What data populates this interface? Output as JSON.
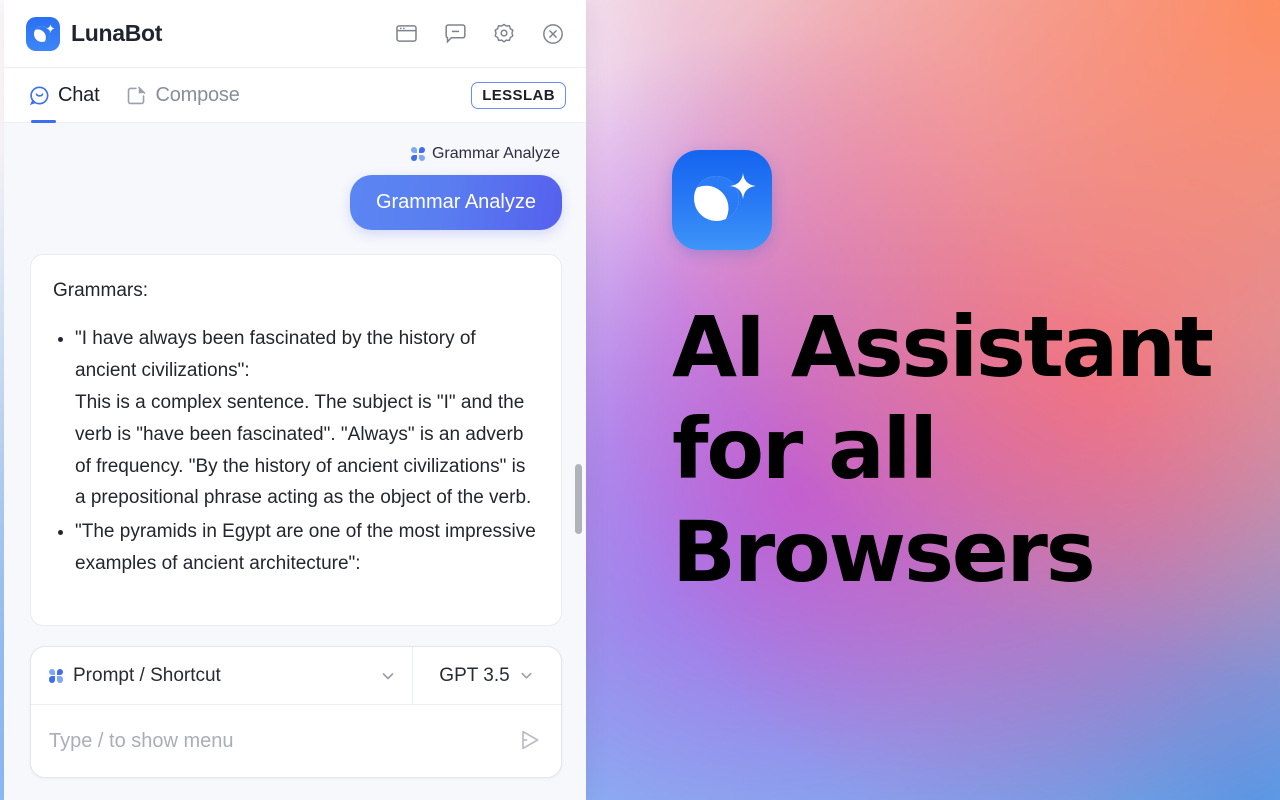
{
  "marketing": {
    "logo_icon": "luna-moon-sparkle-logo",
    "headline_lines": [
      "AI Assistant",
      "for all",
      "Browsers"
    ]
  },
  "titlebar": {
    "brand_name": "LunaBot",
    "logo_icon": "luna-moon-sparkle-logo",
    "actions": [
      {
        "icon": "sidebar-panel-icon",
        "name": "sidebar-toggle-button"
      },
      {
        "icon": "chat-minus-icon",
        "name": "collapse-chat-button"
      },
      {
        "icon": "gear-icon",
        "name": "settings-button"
      },
      {
        "icon": "close-circle-icon",
        "name": "close-button"
      }
    ]
  },
  "tabbar": {
    "tabs": [
      {
        "label": "Chat",
        "icon": "chat-smile-icon",
        "active": true
      },
      {
        "label": "Compose",
        "icon": "compose-pencil-icon",
        "active": false
      }
    ],
    "badge": "LESSLAB"
  },
  "conversation": {
    "prompt_label": "Grammar Analyze",
    "prompt_label_icon": "clover-four-dots-icon",
    "user_message": "Grammar Analyze",
    "assistant": {
      "intro": "Grammars:",
      "items": [
        {
          "quote": "\"I have always been fascinated by the history of ancient civilizations\":",
          "body": "This is a complex sentence. The subject is \"I\" and the verb is \"have been fascinated\". \"Always\" is an adverb of frequency. \"By the history of ancient civilizations\" is a prepositional phrase acting as the object of the verb."
        },
        {
          "quote": "\"The pyramids in Egypt are one of the most impressive examples of ancient architecture\":",
          "body": ""
        }
      ]
    }
  },
  "composer": {
    "prompt_selector_label": "Prompt / Shortcut",
    "prompt_selector_icon": "clover-four-dots-icon",
    "prompt_selector_chevron": "chevron-down-icon",
    "model_label": "GPT 3.5",
    "model_chevron": "chevron-down-icon",
    "input_placeholder": "Type / to show menu",
    "input_value": "",
    "send_icon": "send-arrow-icon"
  },
  "colors": {
    "accent_blue": "#3b6ef0",
    "bubble_gradient_start": "#5b86f2",
    "bubble_gradient_end": "#5560ee",
    "panel_bg": "#f7f8fc",
    "badge_border": "#6a8cf5"
  }
}
